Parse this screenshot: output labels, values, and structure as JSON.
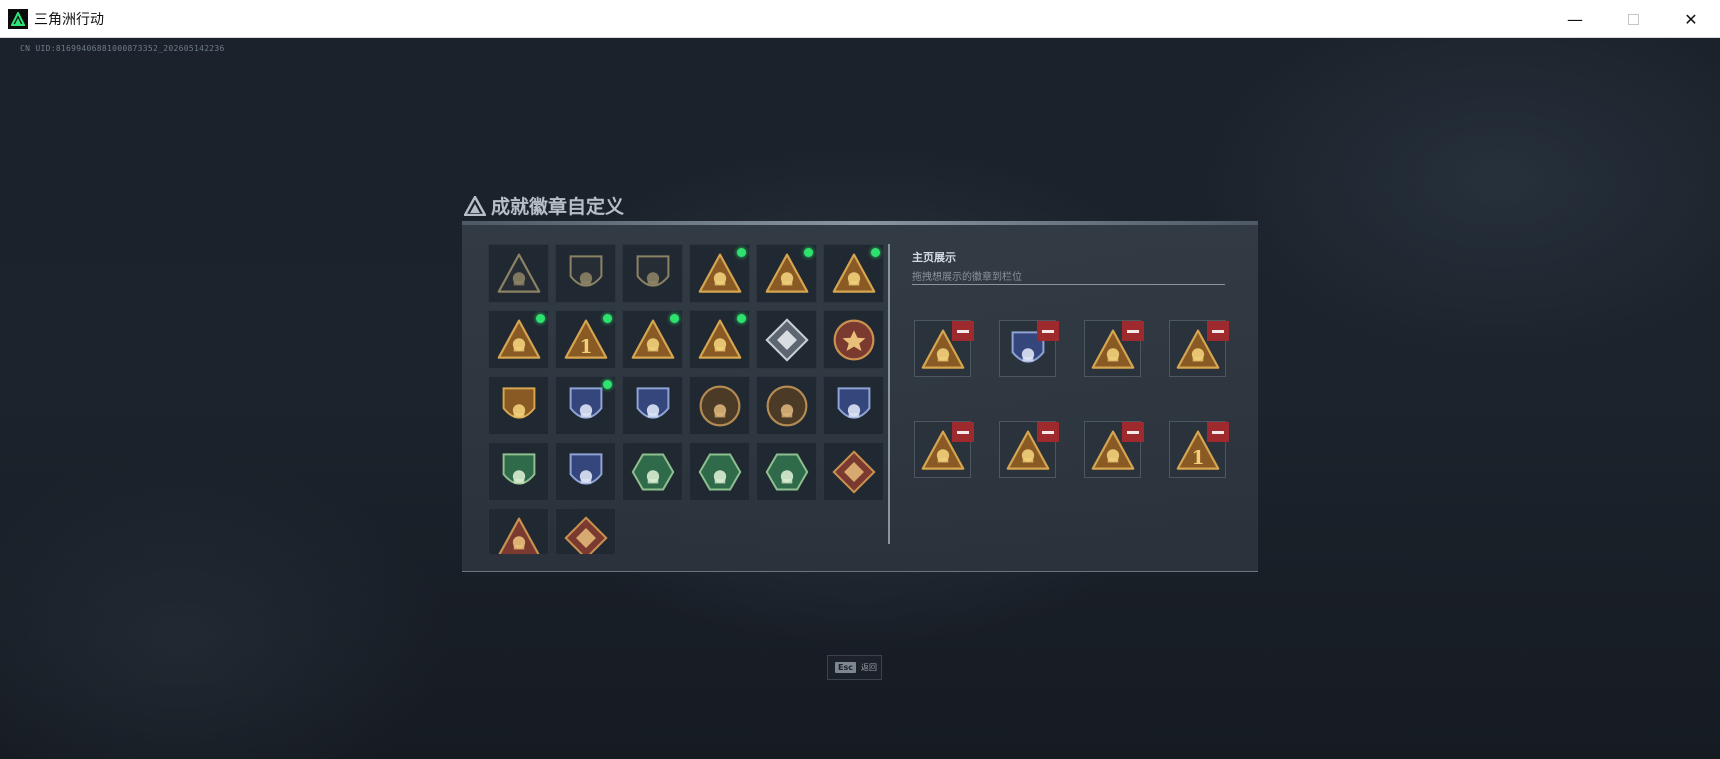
{
  "window": {
    "title": "三角洲行动",
    "minimize": "—",
    "close": "✕"
  },
  "uid": "CN UID:81699406881000873352_202605142236",
  "panel": {
    "title": "成就徽章自定义"
  },
  "display": {
    "title": "主页展示",
    "subtitle": "拖拽想展示的徽章到栏位"
  },
  "colors": {
    "gold": "#c89a4e",
    "new_dot": "#2ee26e",
    "remove": "#9f2a2d",
    "green_badge": "#2f6b4a",
    "blue_badge": "#3b4e86",
    "red_badge": "#7b3a2f"
  },
  "badges": [
    {
      "icon": "triangle-emblem-icon",
      "style": "dark",
      "new": false
    },
    {
      "icon": "helicopter-icon",
      "style": "dark",
      "new": false
    },
    {
      "icon": "arrowhead-shield-icon",
      "style": "dark",
      "new": false
    },
    {
      "icon": "crown-triangle-icon",
      "style": "gold",
      "new": true
    },
    {
      "icon": "armored-vehicle-icon",
      "style": "gold",
      "new": true
    },
    {
      "icon": "hand-sign-icon",
      "style": "gold",
      "new": true
    },
    {
      "icon": "helmet-triangle-icon",
      "style": "gold",
      "new": true
    },
    {
      "icon": "number-one-icon",
      "style": "gold",
      "new": true
    },
    {
      "icon": "gold-crown-icon",
      "style": "gold",
      "new": true
    },
    {
      "icon": "fortress-icon",
      "style": "gold",
      "new": true
    },
    {
      "icon": "silver-diamond-icon",
      "style": "silver",
      "new": false
    },
    {
      "icon": "star-seal-icon",
      "style": "red",
      "new": false
    },
    {
      "icon": "laurel-shield-icon",
      "style": "gold",
      "new": false
    },
    {
      "icon": "cross-medal-icon",
      "style": "blue",
      "new": true
    },
    {
      "icon": "eagle-shield-icon",
      "style": "blue",
      "new": false
    },
    {
      "icon": "knot-coin-icon",
      "style": "bronze",
      "new": false
    },
    {
      "icon": "skull-coin-icon",
      "style": "bronze",
      "new": false
    },
    {
      "icon": "winged-sword-icon",
      "style": "blue",
      "new": false
    },
    {
      "icon": "green-target-icon",
      "style": "green",
      "new": false
    },
    {
      "icon": "winged-crest-icon",
      "style": "blue",
      "new": false
    },
    {
      "icon": "hornet-hex-icon",
      "style": "green",
      "new": false
    },
    {
      "icon": "soldier-hex-icon",
      "style": "green",
      "new": false
    },
    {
      "icon": "fist-hex-icon",
      "style": "green",
      "new": false
    },
    {
      "icon": "dragon-diamond-icon",
      "style": "red",
      "new": false
    },
    {
      "icon": "dragon-head-icon",
      "style": "red",
      "new": false
    },
    {
      "icon": "fighter-diamond-icon",
      "style": "red",
      "new": false
    }
  ],
  "slots": [
    {
      "icon": "hand-sign-icon",
      "style": "gold"
    },
    {
      "icon": "cross-medal-icon",
      "style": "blue"
    },
    {
      "icon": "gold-crown-icon",
      "style": "gold"
    },
    {
      "icon": "crown-triangle-icon",
      "style": "gold"
    },
    {
      "icon": "fortress-icon",
      "style": "gold"
    },
    {
      "icon": "armored-vehicle-icon",
      "style": "gold"
    },
    {
      "icon": "helmet-triangle-icon",
      "style": "gold"
    },
    {
      "icon": "number-one-icon",
      "style": "gold"
    }
  ],
  "esc": {
    "key": "Esc",
    "label": "返回"
  }
}
